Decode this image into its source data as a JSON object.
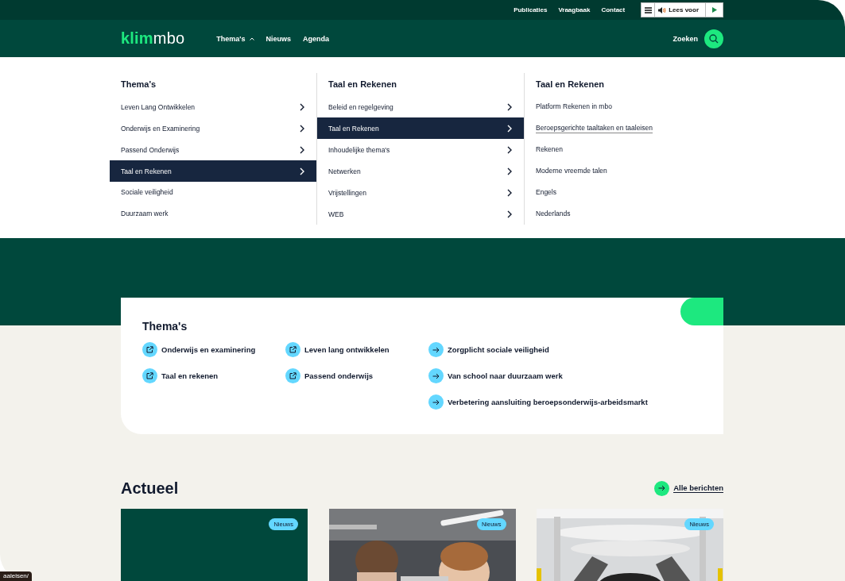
{
  "utility_links": [
    "Publicaties",
    "Vraagbaak",
    "Contact"
  ],
  "read_aloud": {
    "label": "Lees voor"
  },
  "logo": {
    "part1": "klim",
    "part2": "mbo"
  },
  "nav": [
    {
      "label": "Thema's",
      "kind": "dropdown",
      "expanded": true
    },
    {
      "label": "Nieuws",
      "kind": "link"
    },
    {
      "label": "Agenda",
      "kind": "link"
    }
  ],
  "search": {
    "label": "Zoeken"
  },
  "mega_menu": {
    "columns": [
      {
        "title": "Thema's",
        "items": [
          {
            "label": "Leven Lang Ontwikkelen",
            "kind": "submenu",
            "selected": false
          },
          {
            "label": "Onderwijs en Examinering",
            "kind": "submenu",
            "selected": false
          },
          {
            "label": "Passend Onderwijs",
            "kind": "submenu",
            "selected": false
          },
          {
            "label": "Taal en Rekenen",
            "kind": "submenu",
            "selected": true
          },
          {
            "label": "Sociale veiligheid",
            "kind": "link",
            "selected": false
          },
          {
            "label": "Duurzaam werk",
            "kind": "link",
            "selected": false
          }
        ]
      },
      {
        "title": "Taal en Rekenen",
        "items": [
          {
            "label": "Beleid en regelgeving",
            "kind": "submenu",
            "selected": false
          },
          {
            "label": "Taal en Rekenen",
            "kind": "submenu",
            "selected": true
          },
          {
            "label": "Inhoudelijke thema's",
            "kind": "submenu",
            "selected": false
          },
          {
            "label": "Netwerken",
            "kind": "submenu",
            "selected": false
          },
          {
            "label": "Vrijstellingen",
            "kind": "submenu",
            "selected": false
          },
          {
            "label": "WEB",
            "kind": "submenu",
            "selected": false
          }
        ]
      },
      {
        "title": "Taal en Rekenen",
        "items": [
          {
            "label": "Platform Rekenen in mbo",
            "kind": "link",
            "selected": false
          },
          {
            "label": "Beroepsgerichte taaltaken en taaleisen",
            "kind": "link",
            "selected": true
          },
          {
            "label": "Rekenen",
            "kind": "link",
            "selected": false
          },
          {
            "label": "Moderne vreemde talen",
            "kind": "link",
            "selected": false
          },
          {
            "label": "Engels",
            "kind": "link",
            "selected": false
          },
          {
            "label": "Nederlands",
            "kind": "link",
            "selected": false
          }
        ]
      }
    ]
  },
  "themes": {
    "title": "Thema's",
    "columns": [
      [
        {
          "label": "Onderwijs en examinering",
          "kind": "external"
        },
        {
          "label": "Taal en rekenen",
          "kind": "external"
        }
      ],
      [
        {
          "label": "Leven lang ontwikkelen",
          "kind": "external"
        },
        {
          "label": "Passend onderwijs",
          "kind": "external"
        }
      ],
      [
        {
          "label": "Zorgplicht sociale veiligheid",
          "kind": "internal"
        },
        {
          "label": "Van school naar duurzaam werk",
          "kind": "internal"
        },
        {
          "label": "Verbetering aansluiting beroepsonderwijs-arbeidsmarkt",
          "kind": "internal"
        }
      ]
    ]
  },
  "news": {
    "title": "Actueel",
    "all_link": "Alle berichten",
    "cards": [
      {
        "tag": "Nieuws",
        "kind": "plain"
      },
      {
        "tag": "Nieuws",
        "kind": "picture"
      },
      {
        "tag": "Nieuws",
        "kind": "picture"
      }
    ]
  },
  "status_url": "aaleisen/"
}
